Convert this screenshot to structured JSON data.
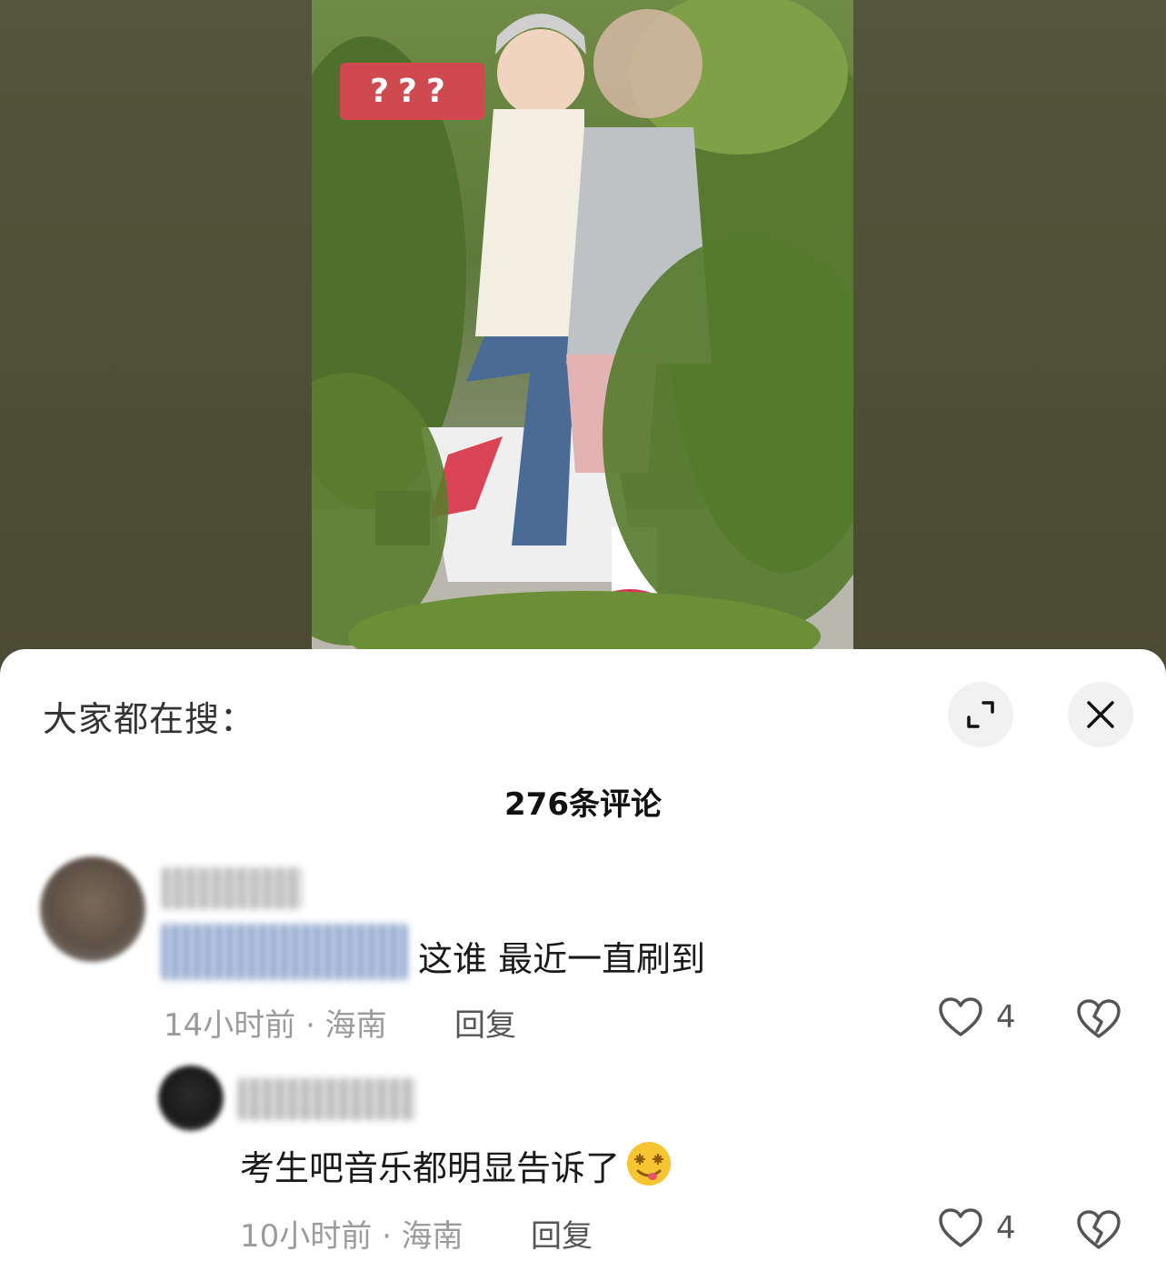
{
  "video": {
    "overlay_text": "???"
  },
  "panel": {
    "search_label": "大家都在搜：",
    "comment_count": "276条评论"
  },
  "comments": [
    {
      "text": "这谁 最近一直刷到",
      "time_location": "14小时前 · 海南",
      "reply_label": "回复",
      "likes": "4"
    },
    {
      "text": "考生吧音乐都明显告诉了",
      "time_location": "10小时前 · 海南",
      "reply_label": "回复",
      "likes": "4"
    }
  ],
  "icons": {
    "expand": "expand-icon",
    "close": "close-icon",
    "like": "heart-icon",
    "dislike": "broken-heart-icon",
    "emoji": "dizzy-face-emoji-icon"
  },
  "colors": {
    "tag": "#cf4a4f",
    "sheet": "#ffffff",
    "meta_text": "#9b9b9b"
  }
}
